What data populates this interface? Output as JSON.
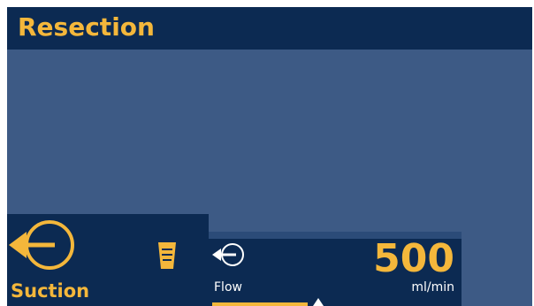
{
  "header": {
    "title": "Resection"
  },
  "suction": {
    "label": "Suction",
    "icons": [
      "suction-arrow-icon",
      "collection-cup-icon"
    ]
  },
  "flow": {
    "label": "Flow",
    "value": "500",
    "unit": "ml/min",
    "icon": "flow-arrow-icon"
  },
  "colors": {
    "background": "#3d5a85",
    "panel": "#0c2a52",
    "accent": "#f4b73b",
    "text": "#ffffff"
  }
}
